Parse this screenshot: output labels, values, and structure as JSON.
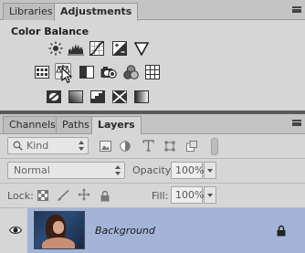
{
  "top_panel": {
    "tabs": [
      {
        "label": "Libraries"
      },
      {
        "label": "Adjustments"
      }
    ],
    "section_title": "Color Balance",
    "adjustment_icons_row1": [
      "brightness-contrast-icon",
      "levels-icon",
      "curves-icon",
      "exposure-icon"
    ],
    "adjustment_icons_row2": [
      "vibrance-icon",
      "color-balance-icon",
      "black-white-icon",
      "photo-filter-icon",
      "channel-mixer-icon",
      "color-lookup-icon"
    ],
    "adjustment_icons_row3": [
      "invert-icon",
      "posterize-icon",
      "threshold-icon",
      "selective-color-icon",
      "gradient-map-icon"
    ]
  },
  "layers_panel": {
    "tabs": [
      {
        "label": "Channels"
      },
      {
        "label": "Paths"
      },
      {
        "label": "Layers"
      }
    ],
    "filter_kind": "Kind",
    "blend_mode": "Normal",
    "opacity_label": "Opacity:",
    "opacity_value": "100%",
    "lock_label": "Lock:",
    "fill_label": "Fill:",
    "fill_value": "100%",
    "layer": {
      "name": "Background"
    }
  },
  "colors": {
    "panel_bg": "#d6d6d6",
    "selected_layer": "#a3b4d8",
    "divider": "#5a5a5a"
  }
}
